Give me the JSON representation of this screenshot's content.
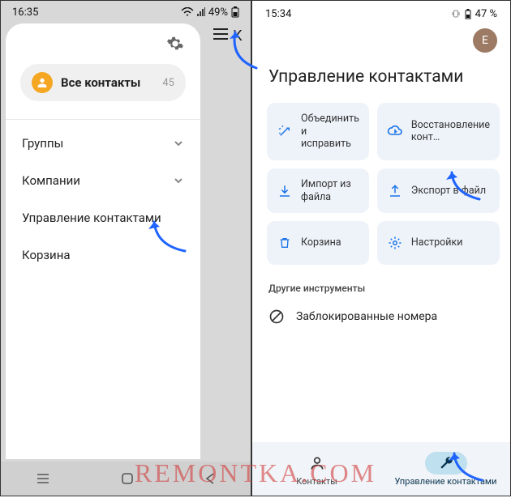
{
  "phone1": {
    "status": {
      "time": "16:35",
      "battery_text": "49%"
    },
    "tail_letter": "К",
    "all_contacts": {
      "label": "Все контакты",
      "count": "45"
    },
    "rows": {
      "groups": "Группы",
      "companies": "Компании",
      "manage": "Управление контактами",
      "trash": "Корзина"
    }
  },
  "phone2": {
    "status": {
      "time": "15:34",
      "battery_text": "47 %"
    },
    "avatar_letter": "E",
    "title": "Управление контактами",
    "cards": {
      "merge": "Объединить и исправить",
      "restore": "Восстановление конт…",
      "import": "Импорт из файла",
      "export": "Экспорт в файл",
      "trash": "Корзина",
      "settings": "Настройки"
    },
    "other_tools": "Другие инструменты",
    "blocked": "Заблокированные номера",
    "tabs": {
      "contacts": "Контакты",
      "manage": "Управление контактами"
    }
  },
  "watermark": "REMONTKA.COM"
}
